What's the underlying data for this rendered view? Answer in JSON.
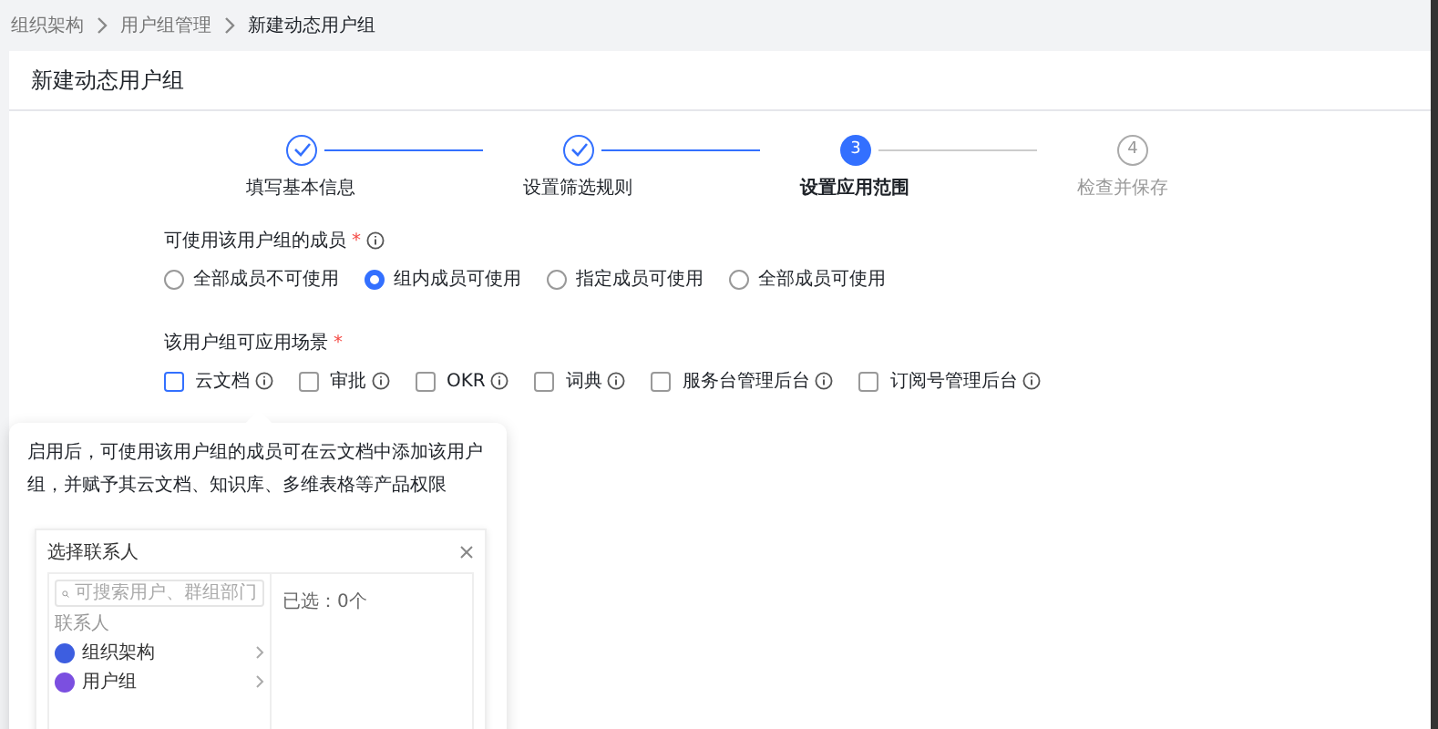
{
  "breadcrumb": [
    "组织架构",
    "用户组管理",
    "新建动态用户组"
  ],
  "card": {
    "title": "新建动态用户组"
  },
  "steps": [
    {
      "label": "填写基本信息",
      "completed": true,
      "selected": false
    },
    {
      "label": "设置筛选规则",
      "completed": true,
      "selected": false
    },
    {
      "number": "3",
      "label": "设置应用范围",
      "completed": false,
      "selected": true
    },
    {
      "number": "4",
      "label": "检查并保存",
      "completed": false,
      "selected": false
    }
  ],
  "members": {
    "label": "可使用该用户组的成员",
    "required_mark": "*",
    "options": [
      {
        "label": "全部成员不可使用",
        "selected": false
      },
      {
        "label": "组内成员可使用",
        "selected": true
      },
      {
        "label": "指定成员可使用",
        "selected": false
      },
      {
        "label": "全部成员可使用",
        "selected": false
      }
    ]
  },
  "scenes": {
    "label": "该用户组可应用场景",
    "required_mark": "*",
    "options": [
      {
        "label": "云文档",
        "checked": false,
        "highlighted": true
      },
      {
        "label": "审批",
        "checked": false,
        "highlighted": false
      },
      {
        "label": "OKR",
        "checked": false,
        "highlighted": false
      },
      {
        "label": "词典",
        "checked": false,
        "highlighted": false
      },
      {
        "label": "服务台管理后台",
        "checked": false,
        "highlighted": false
      },
      {
        "label": "订阅号管理后台",
        "checked": false,
        "highlighted": false
      }
    ]
  },
  "tooltip": {
    "text": "启用后，可使用该用户组的成员可在云文档中添加该用户组，并赋予其云文档、知识库、多维表格等产品权限",
    "preview": {
      "title": "选择联系人",
      "search_placeholder": "可搜索用户、群组部门",
      "section": "联系人",
      "items": [
        {
          "label": "组织架构",
          "color": "#3d5ee0"
        },
        {
          "label": "用户组",
          "color": "#7b4fe0"
        }
      ],
      "selected_count": "已选：0个"
    }
  }
}
